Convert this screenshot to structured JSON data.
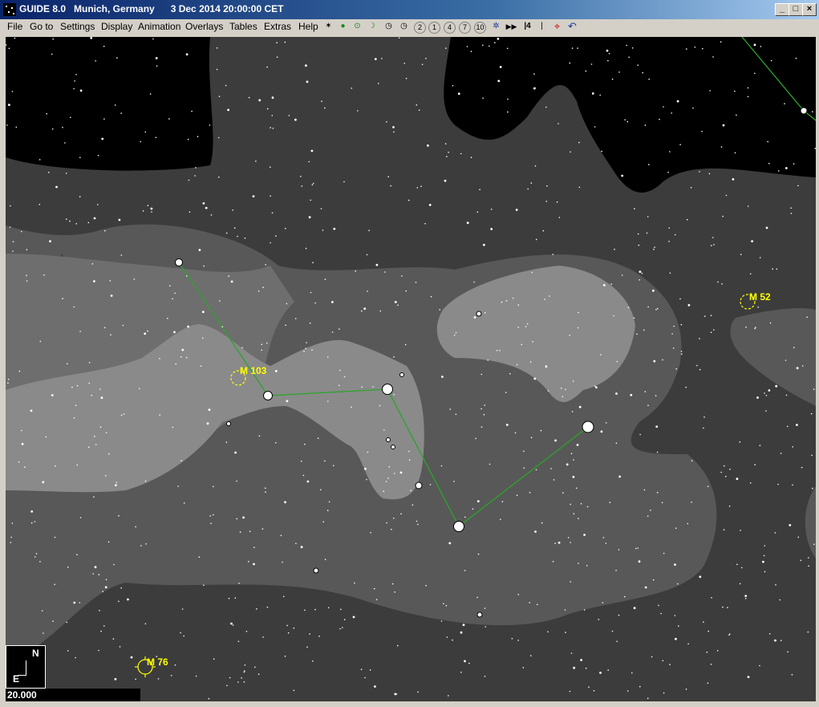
{
  "window": {
    "title": "GUIDE 8.0   Munich, Germany      3 Dec 2014 20:00:00 CET",
    "min_label": "_",
    "max_label": "□",
    "close_label": "×"
  },
  "menu": [
    {
      "label": "File"
    },
    {
      "label": "Go to"
    },
    {
      "label": "Settings"
    },
    {
      "label": "Display"
    },
    {
      "label": "Animation"
    },
    {
      "label": "Overlays"
    },
    {
      "label": "Tables"
    },
    {
      "label": "Extras"
    },
    {
      "label": "Help"
    }
  ],
  "toolbar": [
    {
      "name": "telescope-icon",
      "glyph": "✶"
    },
    {
      "name": "planet-icon",
      "glyph": "●"
    },
    {
      "name": "sun-icon",
      "glyph": "⊙"
    },
    {
      "name": "moon-icon",
      "glyph": "☽"
    },
    {
      "name": "clock-icon",
      "glyph": "◷"
    },
    {
      "name": "clock-icon",
      "glyph": "◷"
    },
    {
      "name": "number-2-icon",
      "glyph": "2"
    },
    {
      "name": "number-1-icon",
      "glyph": "1"
    },
    {
      "name": "number-4-icon",
      "glyph": "4"
    },
    {
      "name": "number-7-icon",
      "glyph": "7"
    },
    {
      "name": "number-10-icon",
      "glyph": "10"
    },
    {
      "name": "snowflake-icon",
      "glyph": "✲"
    },
    {
      "name": "fast-forward-icon",
      "glyph": "▶▶"
    },
    {
      "name": "step-icon",
      "glyph": "|4"
    },
    {
      "name": "pause-icon",
      "glyph": "|"
    },
    {
      "name": "target-icon",
      "glyph": "⌖"
    },
    {
      "name": "undo-icon",
      "glyph": "↶"
    }
  ],
  "chart": {
    "objects": [
      {
        "label": "M 103"
      },
      {
        "label": "M 52"
      },
      {
        "label": "M 76"
      }
    ],
    "compass": {
      "north": "N",
      "east": "E"
    },
    "field_of_view": "20.000"
  },
  "colors": {
    "sky": "#000000",
    "milkyway_outer": "#3c3c3c",
    "milkyway_mid": "#585858",
    "milkyway_inner": "#6e6e6e",
    "milkyway_core": "#8a8a8a",
    "constellation_line": "#2aa52a",
    "deep_sky_label": "#ffff00"
  }
}
